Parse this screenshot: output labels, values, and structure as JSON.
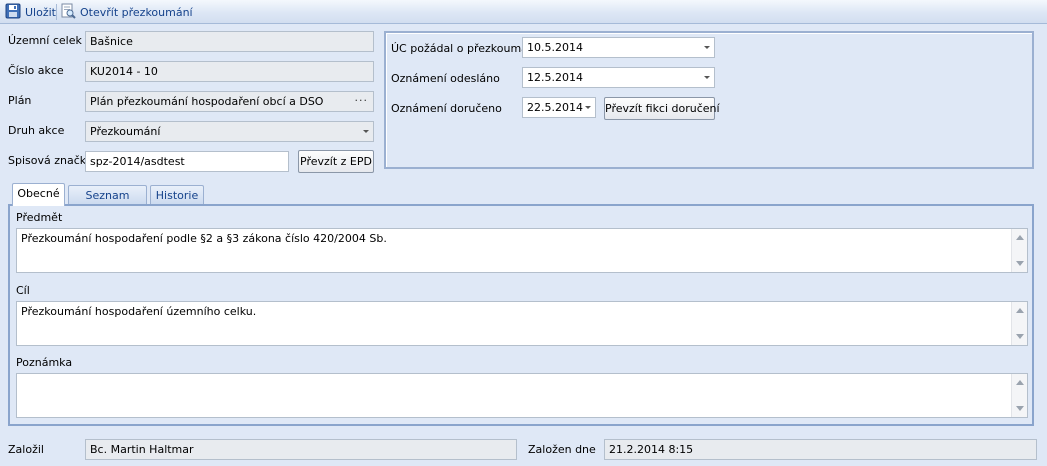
{
  "toolbar": {
    "save_label": "Uložit",
    "open_review_label": "Otevřít přezkoumání"
  },
  "form": {
    "uzemni_celek": {
      "label": "Územní celek",
      "value": "Bašnice"
    },
    "cislo_akce": {
      "label": "Číslo akce",
      "value": "KU2014 - 10"
    },
    "plan": {
      "label": "Plán",
      "value": "Plán přezkoumání hospodaření obcí a DSO",
      "button": "···"
    },
    "druh_akce": {
      "label": "Druh akce",
      "value": "Přezkoumání"
    },
    "spisova_znacka": {
      "label": "Spisová značka",
      "value": "spz-2014/asdtest",
      "button": "Převzít z EPD"
    }
  },
  "dates": {
    "pozadal": {
      "label": "ÚC požádal o přezkoumání",
      "value": "10.5.2014"
    },
    "odeslano": {
      "label": "Oznámení odesláno",
      "value": "12.5.2014"
    },
    "doruceno": {
      "label": "Oznámení doručeno",
      "value": "22.5.2014",
      "button": "Převzít fikci doručení"
    }
  },
  "tabs": [
    {
      "label": "Obecné",
      "active": true
    },
    {
      "label": "Seznam úkolů",
      "active": false
    },
    {
      "label": "Historie",
      "active": false
    }
  ],
  "general": {
    "predmet": {
      "label": "Předmět",
      "value": "Přezkoumání hospodaření podle §2 a §3 zákona číslo 420/2004 Sb."
    },
    "cil": {
      "label": "Cíl",
      "value": "Přezkoumání hospodaření územního celku."
    },
    "poznamka": {
      "label": "Poznámka",
      "value": ""
    }
  },
  "footer": {
    "zalozil": {
      "label": "Založil",
      "value": "Bc. Martin Haltmar"
    },
    "zalozen_dne": {
      "label": "Založen dne",
      "value": "21.2.2014 8:15"
    }
  },
  "colors": {
    "background": "#dfe8f6",
    "toolbar_text": "#15428b",
    "group_border": "#9bb0d1",
    "readonly_field": "#e8ebef"
  },
  "icons": {
    "save": "floppy-disk-icon",
    "open_review": "document-magnifier-icon"
  }
}
